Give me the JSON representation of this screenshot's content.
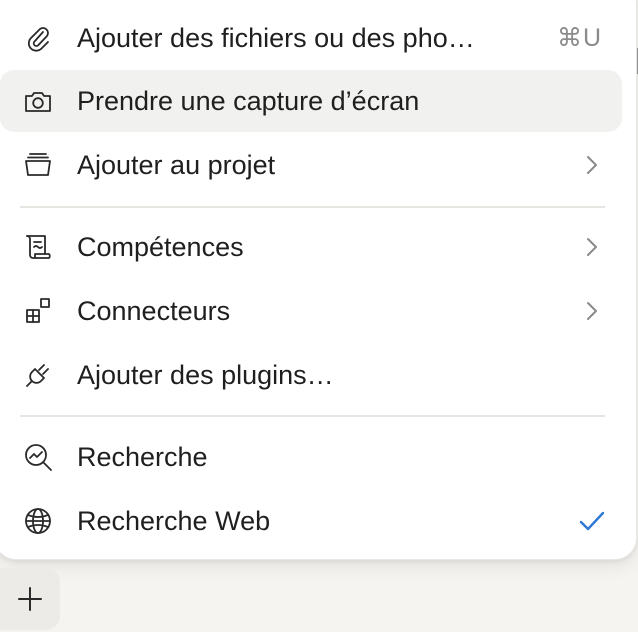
{
  "menu": {
    "items": [
      {
        "label": "Ajouter des fichiers ou des pho…",
        "shortcut": "⌘U",
        "icon": "paperclip-icon"
      },
      {
        "label": "Prendre une capture d’écran",
        "icon": "camera-icon",
        "highlighted": true
      },
      {
        "label": "Ajouter au projet",
        "icon": "project-stack-icon",
        "submenu": true
      },
      {
        "label": "Compétences",
        "icon": "scroll-icon",
        "submenu": true
      },
      {
        "label": "Connecteurs",
        "icon": "connectors-grid-icon",
        "submenu": true
      },
      {
        "label": "Ajouter des plugins…",
        "icon": "plug-icon"
      },
      {
        "label": "Recherche",
        "icon": "research-magnifier-icon"
      },
      {
        "label": "Recherche Web",
        "icon": "globe-icon",
        "checked": true
      }
    ]
  },
  "colors": {
    "check": "#2f78d4",
    "highlight_bg": "#f1f1ef",
    "menu_bg": "#ffffff",
    "shortcut_text": "#8a8a8a"
  }
}
